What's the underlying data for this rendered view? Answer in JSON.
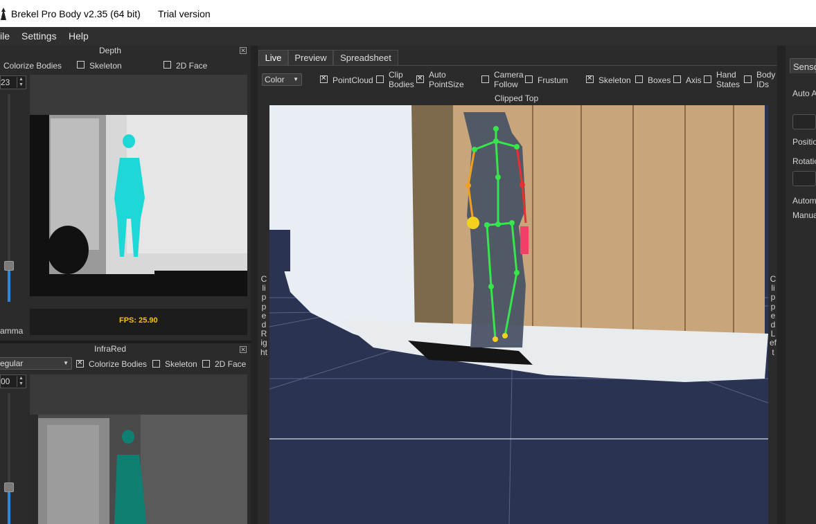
{
  "titlebar": {
    "title": "Brekel Pro Body v2.35 (64 bit)",
    "trial": "Trial version"
  },
  "menu": {
    "file": "ile",
    "settings": "Settings",
    "help": "Help"
  },
  "depth": {
    "title": "Depth",
    "colorize_bodies": "Colorize Bodies",
    "skeleton": "Skeleton",
    "face2d": "2D Face",
    "spin_value": "23",
    "fps": "FPS: 25.90",
    "gamma_label": "amma"
  },
  "infrared": {
    "title": "InfraRed",
    "mode": "egular",
    "colorize_bodies": "Colorize Bodies",
    "skeleton": "Skeleton",
    "face2d": "2D Face",
    "spin_value": "00"
  },
  "tabs": {
    "live": "Live",
    "preview": "Preview",
    "spreadsheet": "Spreadsheet"
  },
  "viewport_toolbar": {
    "color_mode": "Color",
    "pointcloud": "PointCloud",
    "clip_bodies_1": "Clip",
    "clip_bodies_2": "Bodies",
    "auto_pointsize_1": "Auto",
    "auto_pointsize_2": "PointSize",
    "camera_follow_1": "Camera",
    "camera_follow_2": "Follow",
    "frustum": "Frustum",
    "skeleton": "Skeleton",
    "boxes": "Boxes",
    "axis": "Axis",
    "hand_states_1": "Hand",
    "hand_states_2": "States",
    "body_ids_1": "Body",
    "body_ids_2": "IDs"
  },
  "viewport": {
    "clipped_top": "Clipped Top",
    "clipped_right": "Clipped Right",
    "clipped_left": "Clipped Left",
    "bg_color": "#2a3352"
  },
  "right_panel": {
    "sensor": "Senso",
    "auto": "Auto A",
    "position": "Positio",
    "rotation": "Rotatio",
    "automatic": "Autom",
    "manual": "Manua"
  },
  "colors": {
    "accent": "#2f86d4",
    "cyan_body": "#1ed8d8",
    "fps": "#f5c400"
  }
}
